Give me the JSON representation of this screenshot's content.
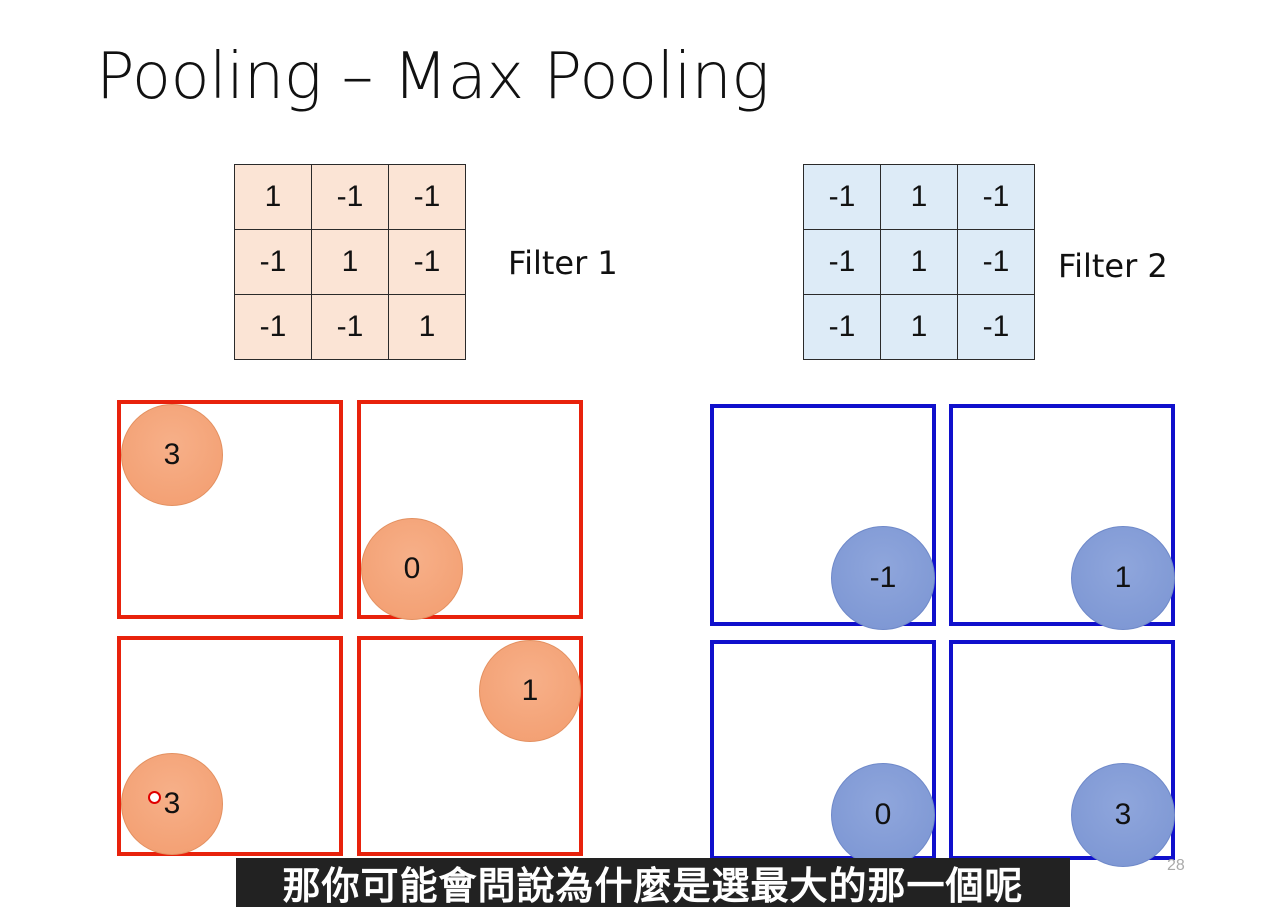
{
  "title": "Pooling – Max Pooling",
  "filter1": {
    "label": "Filter 1",
    "rows": [
      [
        "1",
        "-1",
        "-1"
      ],
      [
        "-1",
        "1",
        "-1"
      ],
      [
        "-1",
        "-1",
        "1"
      ]
    ],
    "color": "#fbe4d5"
  },
  "filter2": {
    "label": "Filter 2",
    "rows": [
      [
        "-1",
        "1",
        "-1"
      ],
      [
        "-1",
        "1",
        "-1"
      ],
      [
        "-1",
        "1",
        "-1"
      ]
    ],
    "color": "#ddebf7"
  },
  "red_values": [
    "3",
    "0",
    "3",
    "1"
  ],
  "blue_values": [
    "-1",
    "1",
    "0",
    "3"
  ],
  "page_number": "28",
  "subtitle": "那你可能會問說為什麼是選最大的那一個呢",
  "colors": {
    "red_box": "#e8220c",
    "blue_box": "#1010cc",
    "orange_circle": "#f4a57a",
    "blue_circle": "#7f98d4"
  }
}
